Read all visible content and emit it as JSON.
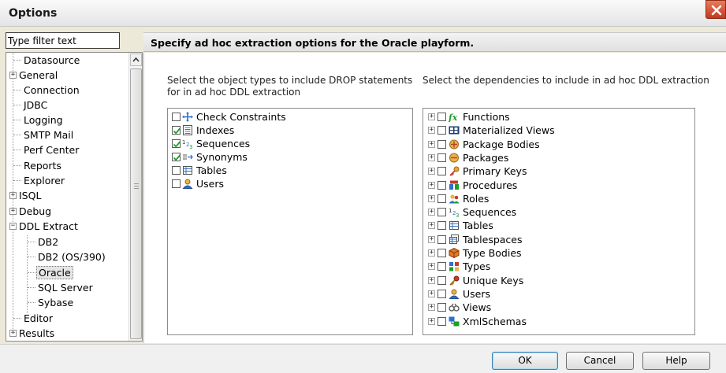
{
  "window": {
    "title": "Options"
  },
  "filter": {
    "placeholder": "Type filter text",
    "value": "Type filter text"
  },
  "tree": {
    "items": [
      {
        "label": "Datasource"
      },
      {
        "label": "General"
      },
      {
        "label": "Connection"
      },
      {
        "label": "JDBC"
      },
      {
        "label": "Logging"
      },
      {
        "label": "SMTP Mail"
      },
      {
        "label": "Perf Center"
      },
      {
        "label": "Reports"
      },
      {
        "label": "Explorer"
      },
      {
        "label": "ISQL"
      },
      {
        "label": "Debug"
      },
      {
        "label": "DDL Extract"
      },
      {
        "label": "DB2"
      },
      {
        "label": "DB2 (OS/390)"
      },
      {
        "label": "Oracle"
      },
      {
        "label": "SQL Server"
      },
      {
        "label": "Sybase"
      },
      {
        "label": "Editor"
      },
      {
        "label": "Results"
      }
    ],
    "selected": "Oracle"
  },
  "content": {
    "header": "Specify ad hoc extraction options for the Oracle playform.",
    "drop_label_1": "Select the object types to include DROP statements",
    "drop_label_2": "for in ad hoc DDL extraction",
    "deps_label": "Select the dependencies to include in ad hoc DDL extraction",
    "drop_items": [
      {
        "label": "Check Constraints",
        "checked": false,
        "icon": "check-constraint-icon"
      },
      {
        "label": "Indexes",
        "checked": true,
        "icon": "index-icon"
      },
      {
        "label": "Sequences",
        "checked": true,
        "icon": "sequence-icon"
      },
      {
        "label": "Synonyms",
        "checked": true,
        "icon": "synonym-icon"
      },
      {
        "label": "Tables",
        "checked": false,
        "icon": "table-icon"
      },
      {
        "label": "Users",
        "checked": false,
        "icon": "user-icon"
      }
    ],
    "dep_items": [
      {
        "label": "Functions",
        "icon": "function-icon"
      },
      {
        "label": "Materialized Views",
        "icon": "materialized-view-icon"
      },
      {
        "label": "Package Bodies",
        "icon": "package-body-icon"
      },
      {
        "label": "Packages",
        "icon": "package-icon"
      },
      {
        "label": "Primary Keys",
        "icon": "primary-key-icon"
      },
      {
        "label": "Procedures",
        "icon": "procedure-icon"
      },
      {
        "label": "Roles",
        "icon": "role-icon"
      },
      {
        "label": "Sequences",
        "icon": "sequence-icon"
      },
      {
        "label": "Tables",
        "icon": "table-icon"
      },
      {
        "label": "Tablespaces",
        "icon": "tablespace-icon"
      },
      {
        "label": "Type Bodies",
        "icon": "type-body-icon"
      },
      {
        "label": "Types",
        "icon": "type-icon"
      },
      {
        "label": "Unique Keys",
        "icon": "unique-key-icon"
      },
      {
        "label": "Users",
        "icon": "user-icon"
      },
      {
        "label": "Views",
        "icon": "view-icon"
      },
      {
        "label": "XmlSchemas",
        "icon": "xml-schema-icon"
      }
    ]
  },
  "footer": {
    "ok_label": "OK",
    "cancel_label": "Cancel",
    "help_label": "Help"
  }
}
